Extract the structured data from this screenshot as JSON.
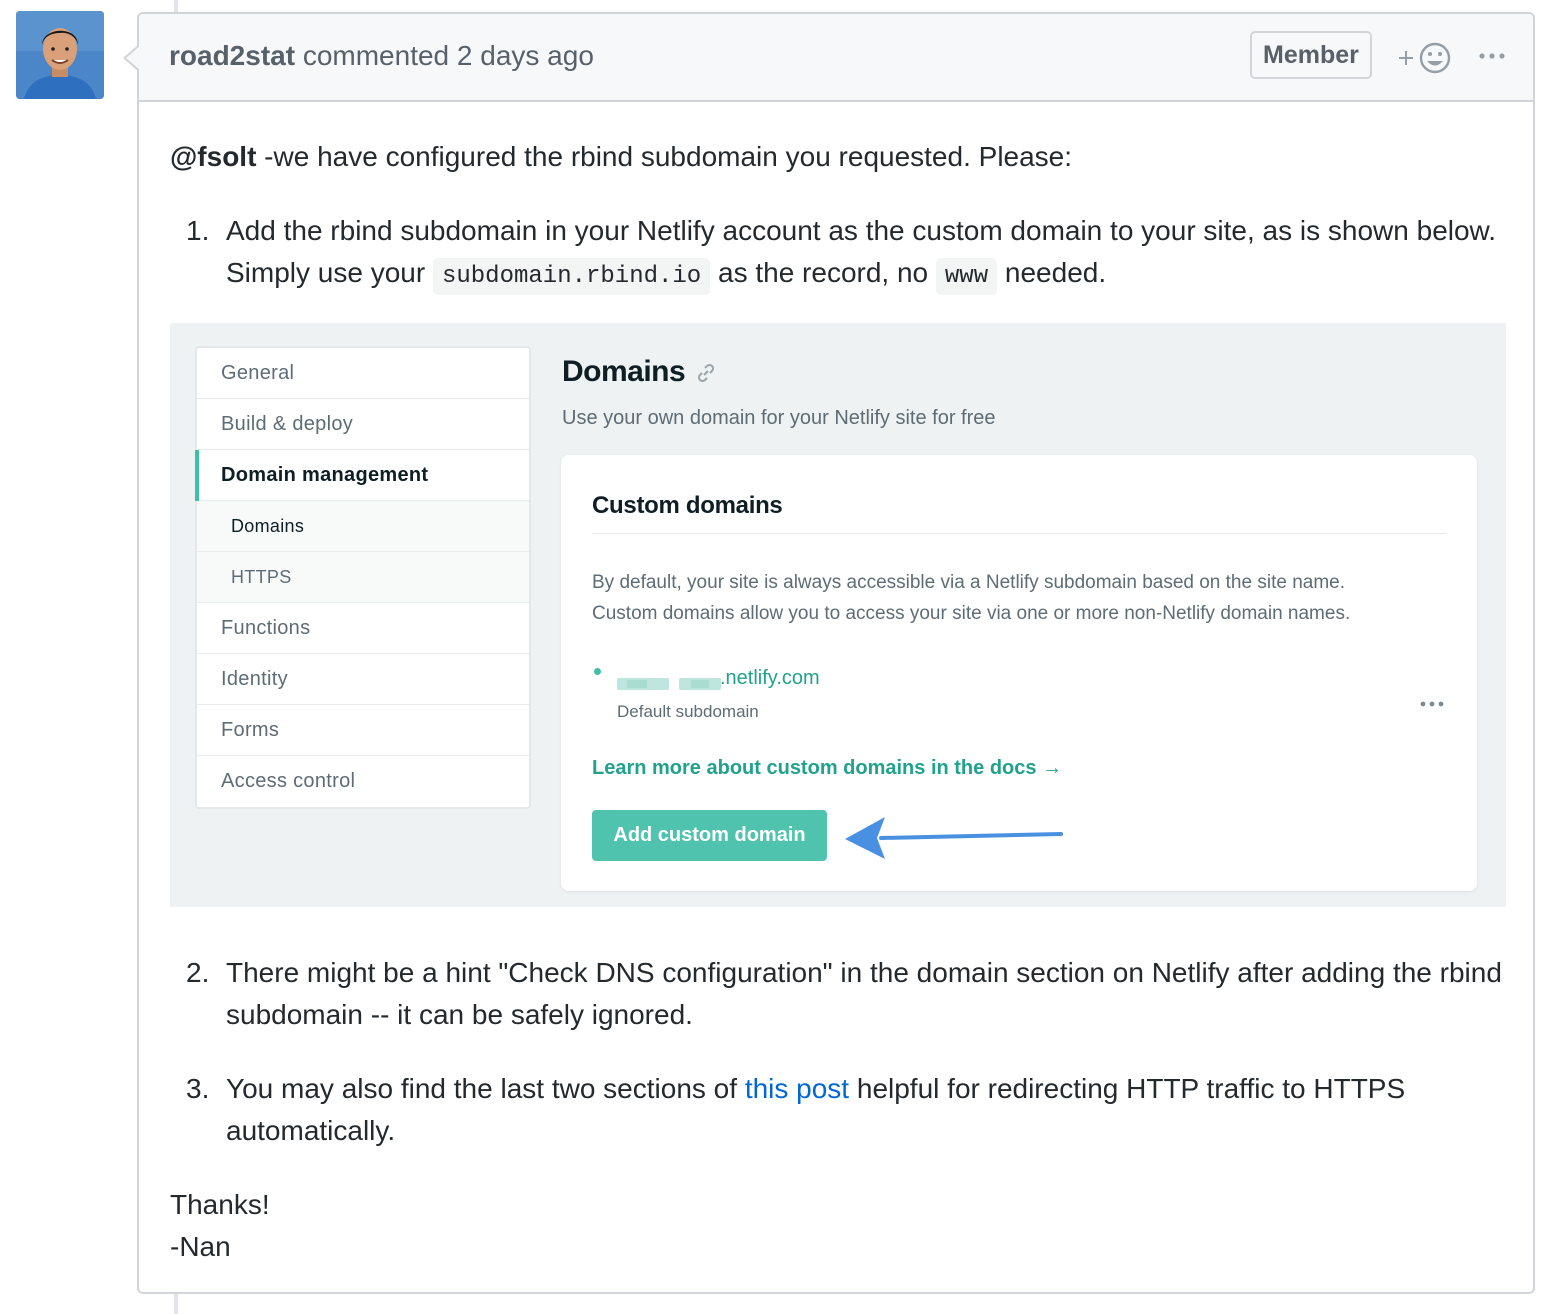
{
  "comment": {
    "author": "road2stat",
    "action": "commented",
    "time": "2 days ago",
    "badge": "Member",
    "reaction_plus": "+"
  },
  "body": {
    "mention": "@fsolt",
    "intro": " -we have configured the rbind subdomain you requested. Please:",
    "item1": {
      "num": "1.",
      "text_a": "Add the rbind subdomain in your Netlify account as the custom domain to your site, as is shown below. Simply use your ",
      "code1": "subdomain.rbind.io",
      "text_b": " as the record, no ",
      "code2": "www",
      "text_c": " needed."
    },
    "item2": {
      "num": "2.",
      "text": "There might be a hint \"Check DNS configuration\" in the domain section on Netlify after adding the rbind subdomain -- it can be safely ignored."
    },
    "item3": {
      "num": "3.",
      "text_a": "You may also find the last two sections of ",
      "link": "this post",
      "text_b": " helpful for redirecting HTTP traffic to HTTPS automatically."
    },
    "thanks": "Thanks!",
    "signature": "-Nan"
  },
  "netlify": {
    "nav": [
      "General",
      "Build & deploy",
      "Domain management",
      "Domains",
      "HTTPS",
      "Functions",
      "Identity",
      "Forms",
      "Access control"
    ],
    "title": "Domains",
    "subtitle": "Use your own domain for your Netlify site for free",
    "card_title": "Custom domains",
    "desc_line1": "By default, your site is always accessible via a Netlify subdomain based on the site name.",
    "desc_line2": "Custom domains allow you to access your site via one or more non-Netlify domain names.",
    "domain_suffix": ".netlify.com",
    "domain_label": "Default subdomain",
    "learn_link": "Learn more about custom domains in the docs",
    "learn_arrow": "→",
    "add_button": "Add custom domain"
  },
  "colors": {
    "netlify_teal": "#4fc3ad",
    "annotation_arrow": "#4a90e2",
    "link_blue": "#0366d6"
  }
}
